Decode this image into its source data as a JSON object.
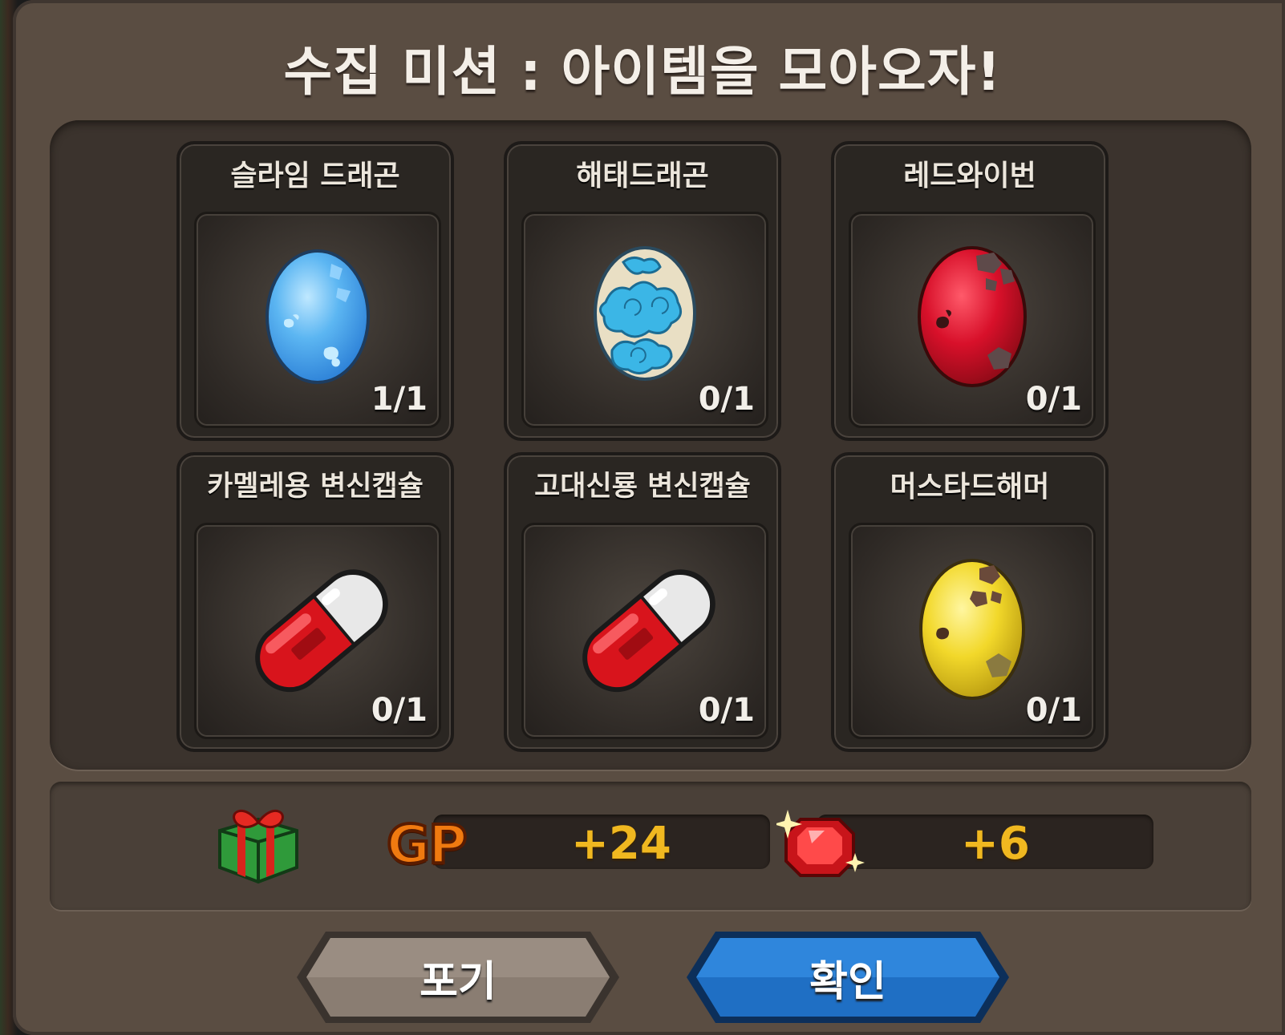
{
  "dialog": {
    "title": "수집 미션 : 아이템을 모아오자!"
  },
  "items": [
    {
      "name": "슬라임 드래곤",
      "count": "1/1",
      "icon": "blue-egg-icon"
    },
    {
      "name": "해태드래곤",
      "count": "0/1",
      "icon": "cloud-egg-icon"
    },
    {
      "name": "레드와이번",
      "count": "0/1",
      "icon": "red-egg-icon"
    },
    {
      "name": "카멜레용 변신캡슐",
      "count": "0/1",
      "icon": "capsule-icon"
    },
    {
      "name": "고대신룡 변신캡슐",
      "count": "0/1",
      "icon": "capsule-icon"
    },
    {
      "name": "머스타드해머",
      "count": "0/1",
      "icon": "yellow-egg-icon"
    }
  ],
  "rewards": {
    "gift_icon": "gift-box-icon",
    "gp_label": "GP",
    "gp_value": "+24",
    "gem_icon": "red-gem-icon",
    "gem_value": "+6"
  },
  "buttons": {
    "cancel_label": "포기",
    "confirm_label": "확인"
  },
  "colors": {
    "dialog_bg": "#5a4d42",
    "panel_bg": "#3b332d",
    "reward_value": "#f0b820",
    "confirm_button": "#1f6fc4",
    "cancel_button": "#7a6d63"
  }
}
